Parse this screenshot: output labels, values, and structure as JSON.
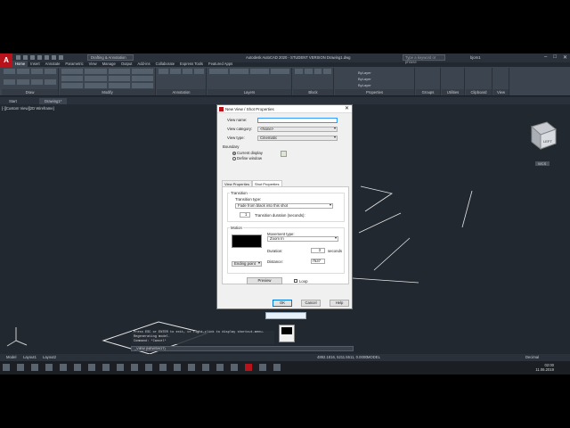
{
  "app": {
    "logo": "A",
    "workspace": "Drafting & Annotation",
    "title": "Autodesk AutoCAD 2020 - STUDENT VERSION   Drawing1.dwg",
    "search_placeholder": "Type a keyword or phrase",
    "user": "bjorn1",
    "window_controls": [
      "–",
      "□",
      "✕"
    ]
  },
  "ribbon": {
    "tabs": [
      "Home",
      "Insert",
      "Annotate",
      "Parametric",
      "View",
      "Manage",
      "Output",
      "Add-ins",
      "Collaborate",
      "Express Tools",
      "Featured Apps"
    ],
    "active_tab": "Home",
    "groups": [
      "Draw",
      "Modify",
      "Annotation",
      "Layers",
      "Block",
      "Properties",
      "Groups",
      "Utilities",
      "Clipboard",
      "View"
    ],
    "properties_values": [
      "ByLayer",
      "ByLayer",
      "ByLayer"
    ]
  },
  "file_tabs": [
    "Start",
    "Drawing1*"
  ],
  "viewport": {
    "label": "[-][Custom View][2D Wireframe]"
  },
  "viewcube": {
    "face": "LEFT",
    "wcs": "WCS"
  },
  "dialog": {
    "title": "New View / Shot Properties",
    "close": "✕",
    "labels": {
      "view_name": "View name:",
      "view_category": "View category:",
      "view_type": "View type:",
      "boundary": "Boundary"
    },
    "values": {
      "view_name": "",
      "view_category": "<None>",
      "view_type": "Cinematic"
    },
    "boundary_options": [
      "Current display",
      "Define window"
    ],
    "tabs": [
      "View Properties",
      "Shot Properties"
    ],
    "active_tab": "Shot Properties",
    "transition": {
      "group_title": "Transition",
      "type_label": "Transition type:",
      "type_value": "Fade from black into this shot",
      "duration_value": "1",
      "duration_label": "Transition duration (seconds):"
    },
    "motion": {
      "group_title": "Motion",
      "movement_type_label": "Movement type:",
      "movement_type_value": "Zoom In",
      "duration_label": "Duration:",
      "duration_value": "3",
      "duration_unit": "seconds",
      "distance_label": "Distance:",
      "distance_value": "7537",
      "point_value": "Ending point"
    },
    "preview_button": "Preview",
    "loop_label": "Loop",
    "ok": "OK",
    "cancel": "Cancel",
    "help": "Help"
  },
  "command": {
    "lines": [
      "Press ESC or ENTER to exit, or right-click to display shortcut-menu.",
      "Regenerating model.",
      "Command: *Cancel*"
    ],
    "prompt": "_VIEW (NEWSHOT)"
  },
  "status": {
    "layout_tabs": [
      "Model",
      "Layout1",
      "Layout2"
    ],
    "coords": "4892.1816, 5211.5511, 0.0000",
    "mode": "MODEL",
    "units": "Decimal"
  },
  "taskbar": {
    "time": "02:00",
    "date": "11.06.2019"
  },
  "colors": {
    "accent": "#b8121b",
    "drawing_bg": "#212830",
    "ribbon_bg": "#3c4450"
  }
}
